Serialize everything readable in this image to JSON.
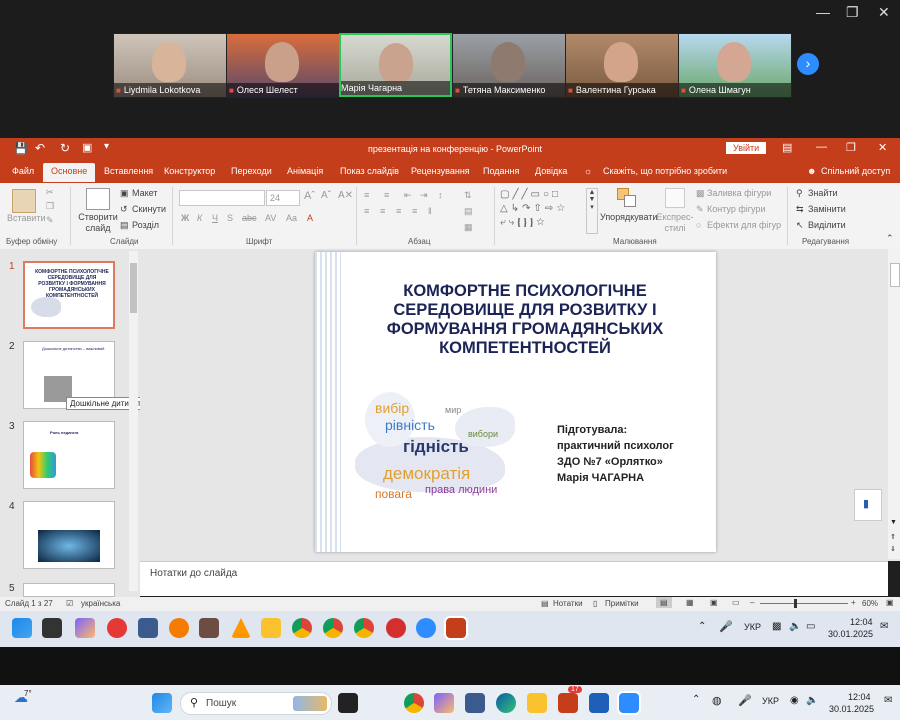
{
  "zoom": {
    "participants": [
      {
        "name": "Liydmila Lokotkova"
      },
      {
        "name": "Олеся Шелест"
      },
      {
        "name": "Марія Чагарна"
      },
      {
        "name": "Тетяна Максименко"
      },
      {
        "name": "Валентина Гурська"
      },
      {
        "name": "Олена Шмагун"
      }
    ]
  },
  "ppt": {
    "title": "презентація на конференцію  -  PowerPoint",
    "signin": "Увійти",
    "share": "Спільний доступ",
    "tell_me": "Скажіть, що потрібно зробити",
    "tabs": [
      "Файл",
      "Основне",
      "Вставлення",
      "Конструктор",
      "Переходи",
      "Анімація",
      "Показ слайдів",
      "Рецензування",
      "Подання",
      "Довідка"
    ],
    "ribbon": {
      "paste": "Вставити",
      "clipboard": "Буфер обміну",
      "create_slide": "Створити слайд",
      "layout": "Макет",
      "reset": "Скинути",
      "section": "Розділ",
      "slides": "Слайди",
      "font": "Шрифт",
      "font_size": "24",
      "paragraph": "Абзац",
      "arrange": "Упорядкувати",
      "quick_styles": "Експрес-стилі",
      "shape_fill": "Заливка фігури",
      "shape_outline": "Контур фігури",
      "shape_effects": "Ефекти для фігур",
      "drawing": "Малювання",
      "find": "Знайти",
      "replace": "Замінити",
      "select": "Виділити",
      "editing": "Редагування"
    },
    "thumbs": [
      {
        "num": "1",
        "title": "КОМФОРТНЕ ПСИХОЛОГІЧНЕ СЕРЕДОВИЩЕ ДЛЯ РОЗВИТКУ І ФОРМУВАННЯ ГРОМАДЯНСЬКИХ КОМПЕТЕНТНОСТЕЙ"
      },
      {
        "num": "2",
        "title": "Дошкільне дитинство – важливий"
      },
      {
        "num": "3",
        "title": "Роль педагога"
      },
      {
        "num": "4",
        "title": ""
      },
      {
        "num": "5",
        "title": ""
      }
    ],
    "tooltip": "Дошкільне дитинство – важливий ...",
    "slide": {
      "title": "КОМФОРТНЕ ПСИХОЛОГІЧНЕ СЕРЕДОВИЩЕ ДЛЯ РОЗВИТКУ І ФОРМУВАННЯ ГРОМАДЯНСЬКИХ КОМПЕТЕНТНОСТЕЙ",
      "prepared_lines": [
        "Підготувала:",
        "практичний психолог",
        "ЗДО №7 «Орлятко»",
        "Марія ЧАГАРНА"
      ],
      "words": [
        "вибір",
        "рівність",
        "гідність",
        "демократія",
        "повага",
        "права людини",
        "вибори",
        "мир"
      ]
    },
    "notes": "Нотатки до слайда",
    "status": {
      "slide_counter": "Слайд 1 з 27",
      "language": "українська",
      "notes_btn": "Нотатки",
      "comments_btn": "Примітки",
      "zoom": "60%"
    }
  },
  "inner_taskbar": {
    "lang": "УКР",
    "time": "12:04",
    "date": "30.01.2025"
  },
  "outer_taskbar": {
    "weather": "7°",
    "search": "Пошук",
    "lang": "УКР",
    "time": "12:04",
    "date": "30.01.2025",
    "badge": "17"
  }
}
